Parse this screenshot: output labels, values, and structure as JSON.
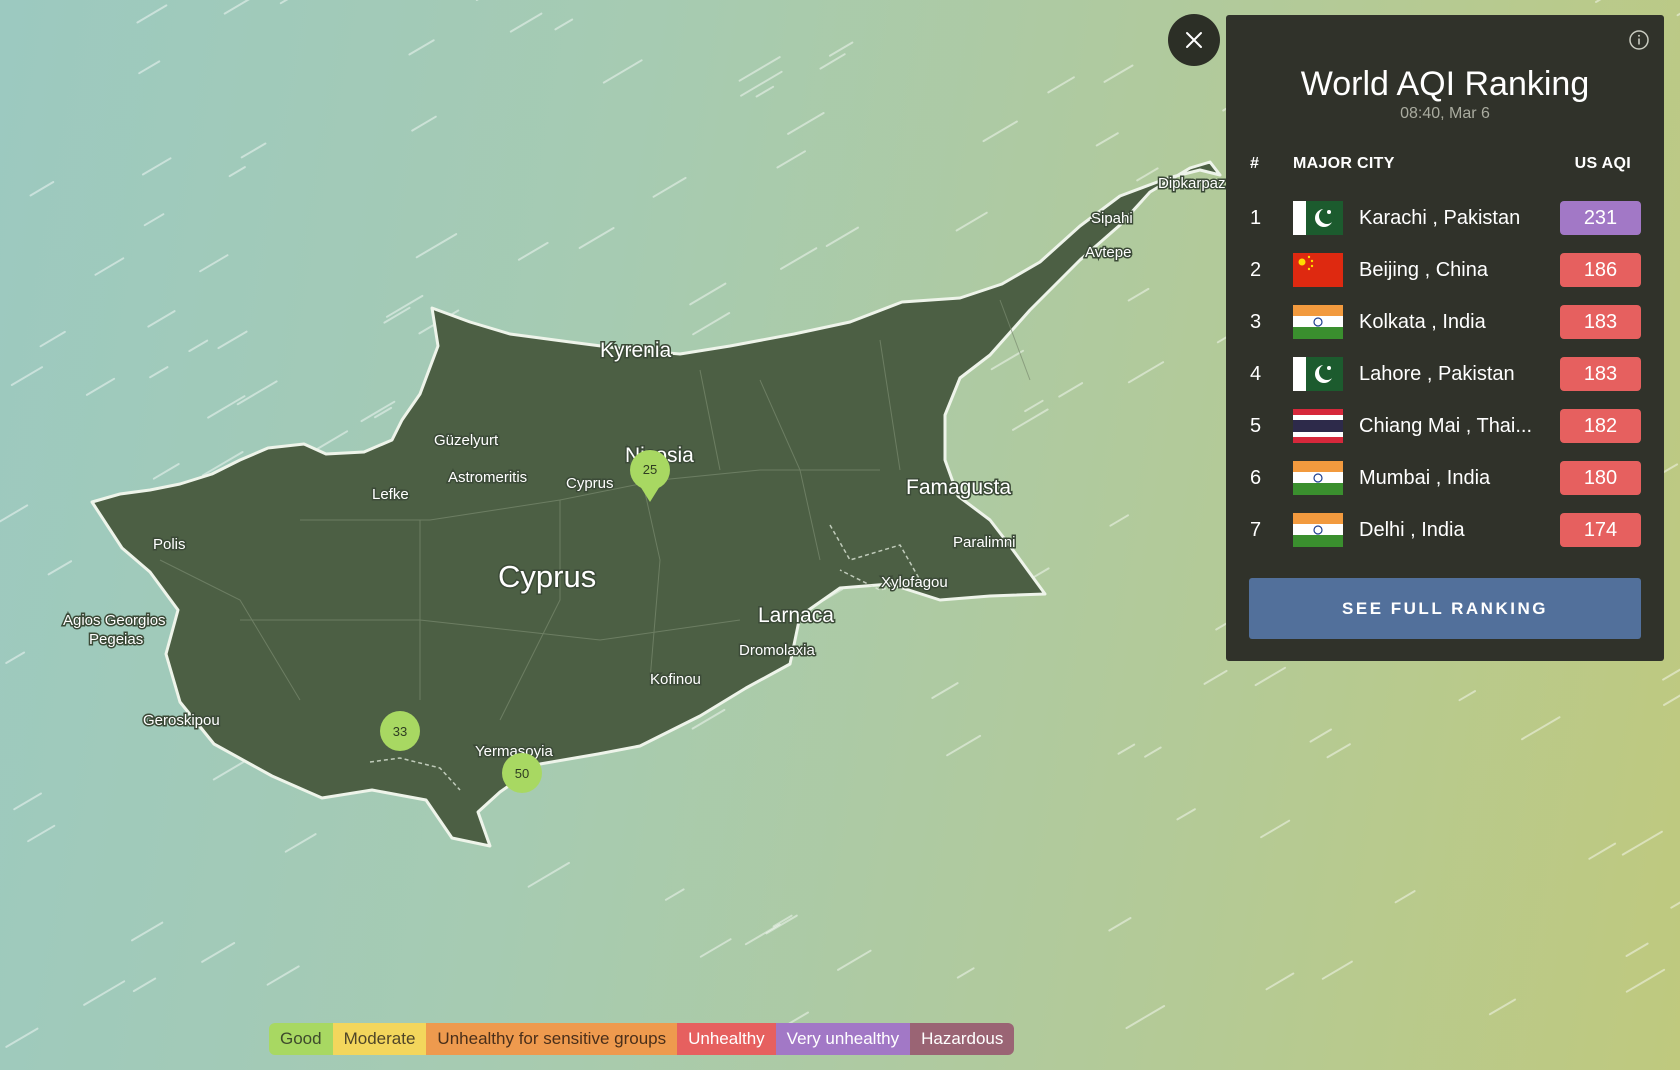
{
  "map": {
    "labels": {
      "country": "Cyprus",
      "kyrenia": "Kyrenia",
      "nicosia": "Nicosia",
      "famagusta": "Famagusta",
      "larnaca": "Larnaca",
      "dipkarpaz": "Dipkarpaz",
      "sipahi": "Sipahi",
      "avtepe": "Avtepe",
      "guzelyurt": "Güzelyurt",
      "astromeritis": "Astromeritis",
      "cyprus_small": "Cyprus",
      "lefke": "Lefke",
      "polis": "Polis",
      "agios_georgios": "Agios Georgios",
      "pegeias": "Pegeias",
      "paralimni": "Paralimni",
      "xylofagou": "Xylofagou",
      "dromolaxia": "Dromolaxia",
      "kofinou": "Kofinou",
      "geroskipou": "Geroskipou",
      "yermasoyia": "Yermasoyia"
    },
    "markers": [
      {
        "id": "nicosia",
        "value": "25",
        "color": "#a8d862"
      },
      {
        "id": "paphos",
        "value": "33",
        "color": "#a8d862"
      },
      {
        "id": "limassol",
        "value": "50",
        "color": "#a8d862"
      }
    ]
  },
  "panel": {
    "title": "World AQI Ranking",
    "timestamp": "08:40, Mar 6",
    "headers": {
      "rank": "#",
      "city": "MAJOR CITY",
      "aqi": "US AQI"
    },
    "rows": [
      {
        "rank": "1",
        "flag": "pakistan-flag-icon",
        "city": "Karachi , Pakistan",
        "aqi": "231",
        "color": "#a278c6"
      },
      {
        "rank": "2",
        "flag": "china-flag-icon",
        "city": "Beijing , China",
        "aqi": "186",
        "color": "#e6605f"
      },
      {
        "rank": "3",
        "flag": "india-flag-icon",
        "city": "Kolkata , India",
        "aqi": "183",
        "color": "#e6605f"
      },
      {
        "rank": "4",
        "flag": "pakistan-flag-icon",
        "city": "Lahore , Pakistan",
        "aqi": "183",
        "color": "#e6605f"
      },
      {
        "rank": "5",
        "flag": "thailand-flag-icon",
        "city": "Chiang Mai , Thai...",
        "aqi": "182",
        "color": "#e6605f"
      },
      {
        "rank": "6",
        "flag": "india-flag-icon",
        "city": "Mumbai , India",
        "aqi": "180",
        "color": "#e6605f"
      },
      {
        "rank": "7",
        "flag": "india-flag-icon",
        "city": "Delhi , India",
        "aqi": "174",
        "color": "#e6605f"
      }
    ],
    "button_label": "SEE FULL RANKING"
  },
  "legend": [
    {
      "label": "Good",
      "bg": "#a8d862",
      "fg": "#3e4a2c"
    },
    {
      "label": "Moderate",
      "bg": "#f3d65c",
      "fg": "#4f4528"
    },
    {
      "label": "Unhealthy for sensitive groups",
      "bg": "#ee9a4e",
      "fg": "#4a2f1a"
    },
    {
      "label": "Unhealthy",
      "bg": "#e6605f",
      "fg": "#ffffff"
    },
    {
      "label": "Very unhealthy",
      "bg": "#a278c6",
      "fg": "#ffffff"
    },
    {
      "label": "Hazardous",
      "bg": "#9a6474",
      "fg": "#ffffff"
    }
  ]
}
